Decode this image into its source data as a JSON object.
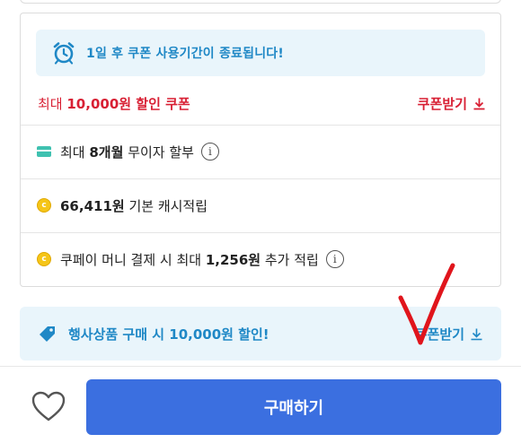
{
  "expire_notice": "1일 후 쿠폰 사용기간이 종료됩니다!",
  "coupon": {
    "prefix": "최대 ",
    "amount": "10,000원",
    "suffix": " 할인 쿠폰",
    "get_label": "쿠폰받기"
  },
  "benefits": {
    "installment": {
      "prefix": "최대 ",
      "bold": "8개월",
      "suffix": " 무이자 할부"
    },
    "cash": {
      "bold": "66,411원",
      "suffix": " 기본 캐시적립"
    },
    "coupay": {
      "prefix": "쿠페이 머니 결제 시 최대 ",
      "bold": "1,256원",
      "suffix": " 추가 적립"
    }
  },
  "event": {
    "text": "행사상품 구매 시 10,000원 할인!",
    "get_label": "쿠폰받기"
  },
  "purchase_label": "구매하기",
  "icons": {
    "info": "i",
    "coin": "c"
  },
  "colors": {
    "info_blue": "#1f88c6",
    "coupon_red": "#d82034",
    "buy_blue": "#3b6fe0",
    "annotation_red": "#e0151c"
  }
}
